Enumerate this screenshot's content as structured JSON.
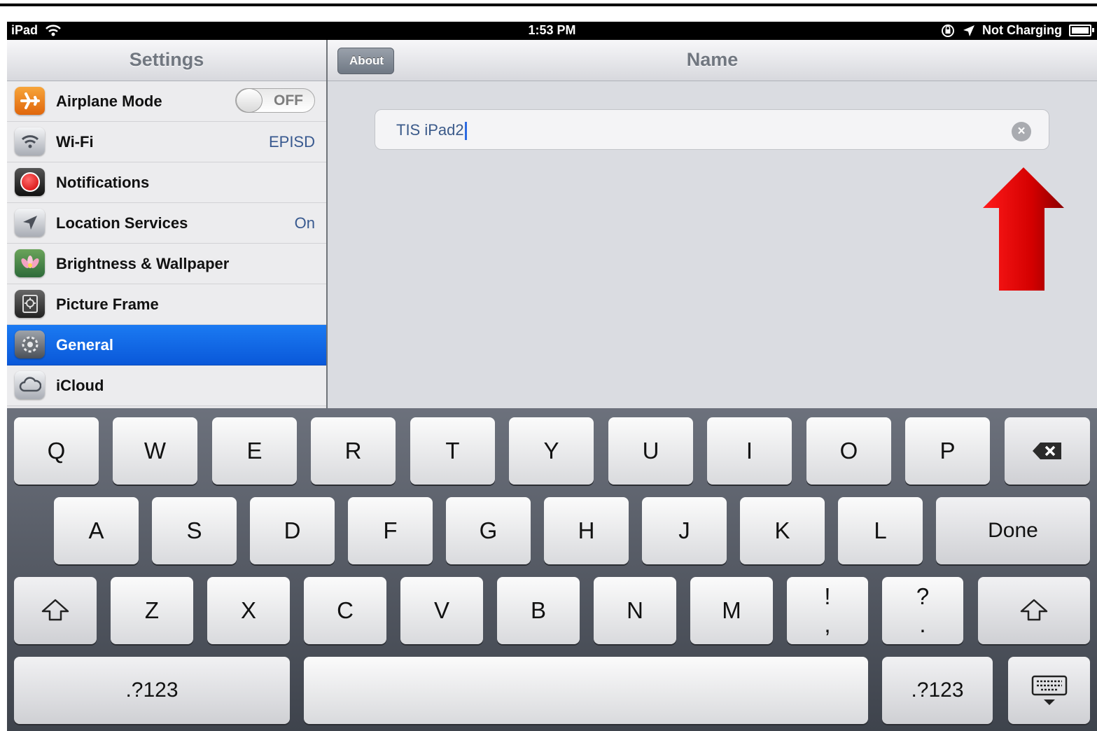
{
  "status_bar": {
    "device": "iPad",
    "time": "1:53 PM",
    "charging": "Not Charging"
  },
  "settings": {
    "title": "Settings",
    "items": [
      {
        "label": "Airplane Mode",
        "value": "",
        "icon": "airplane-icon"
      },
      {
        "label": "Wi-Fi",
        "value": "EPISD",
        "icon": "wifi-icon"
      },
      {
        "label": "Notifications",
        "value": "",
        "icon": "notifications-icon"
      },
      {
        "label": "Location Services",
        "value": "On",
        "icon": "location-icon"
      },
      {
        "label": "Brightness & Wallpaper",
        "value": "",
        "icon": "flower-icon"
      },
      {
        "label": "Picture Frame",
        "value": "",
        "icon": "picture-frame-icon"
      },
      {
        "label": "General",
        "value": "",
        "icon": "gear-icon"
      },
      {
        "label": "iCloud",
        "value": "",
        "icon": "cloud-icon"
      }
    ],
    "airplane_toggle": "OFF"
  },
  "detail": {
    "back": "About",
    "title": "Name",
    "name_value": "TIS iPad2"
  },
  "keyboard": {
    "row1": [
      "Q",
      "W",
      "E",
      "R",
      "T",
      "Y",
      "U",
      "I",
      "O",
      "P"
    ],
    "row2": [
      "A",
      "S",
      "D",
      "F",
      "G",
      "H",
      "J",
      "K",
      "L"
    ],
    "row3": [
      "Z",
      "X",
      "C",
      "V",
      "B",
      "N",
      "M"
    ],
    "done": "Done",
    "exclam_top": "!",
    "exclam_bottom": ",",
    "question_top": "?",
    "question_bottom": ".",
    "numbers": ".?123",
    "shift_symbol": "⇧",
    "delete_symbol": "⌫",
    "hide_symbol": "⌨"
  },
  "colors": {
    "selected_row": "#0a64e4",
    "value_text": "#38598f",
    "arrow": "#d40000"
  }
}
